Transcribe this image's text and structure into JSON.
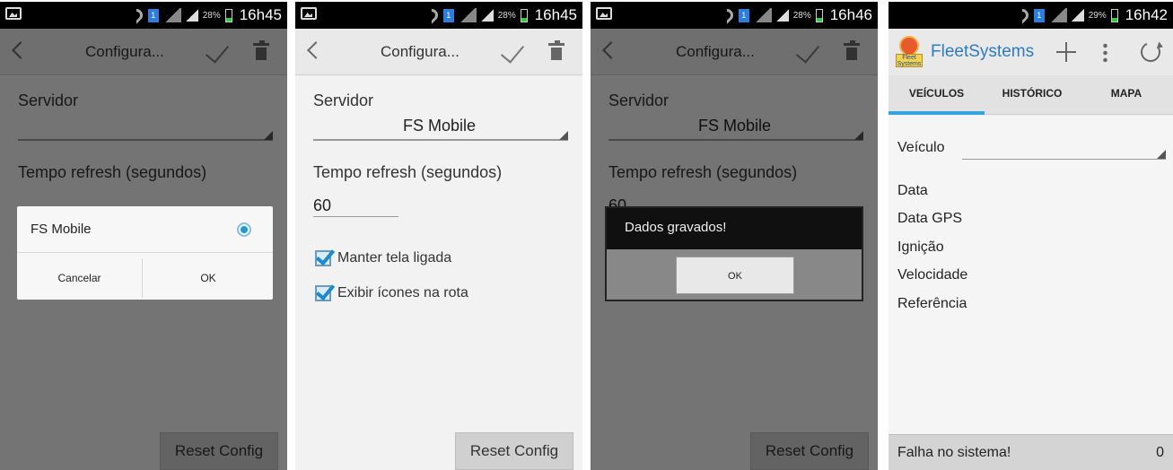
{
  "statusbars": [
    {
      "battery_pct": "28%",
      "time": "16h45",
      "sim": "1"
    },
    {
      "battery_pct": "28%",
      "time": "16h45",
      "sim": "1"
    },
    {
      "battery_pct": "28%",
      "time": "16h46",
      "sim": "1"
    },
    {
      "battery_pct": "29%",
      "time": "16h42",
      "sim": "1"
    }
  ],
  "config": {
    "title": "Configura...",
    "server_label": "Servidor",
    "server_value": "FS Mobile",
    "refresh_label": "Tempo refresh (segundos)",
    "refresh_value": "60",
    "checkbox_keep_screen": "Manter tela ligada",
    "checkbox_show_icons": "Exibir ícones na rota",
    "reset_button": "Reset Config"
  },
  "select_dialog": {
    "option": "FS Mobile",
    "cancel": "Cancelar",
    "ok": "OK"
  },
  "saved_dialog": {
    "message": "Dados gravados!",
    "ok": "OK",
    "partial_refresh": "60"
  },
  "fleet": {
    "app_title": "FleetSystems",
    "logo_text": "Fleet Systems",
    "tabs": [
      "VEÍCULOS",
      "HISTÓRICO",
      "MAPA"
    ],
    "vehicle_label": "Veículo",
    "fields": [
      "Data",
      "Data GPS",
      "Ignição",
      "Velocidade",
      "Referência"
    ],
    "status": "Falha no sistema!",
    "count": "0"
  },
  "icons": {
    "back": "back-arrow-icon",
    "save": "check-icon",
    "delete": "trash-icon",
    "add": "plus-icon",
    "overflow": "more-vertical-icon",
    "refresh": "refresh-icon"
  },
  "colors": {
    "accent": "#34a4e0",
    "title_blue": "#2b7cc4",
    "radio": "#1f97dd"
  }
}
